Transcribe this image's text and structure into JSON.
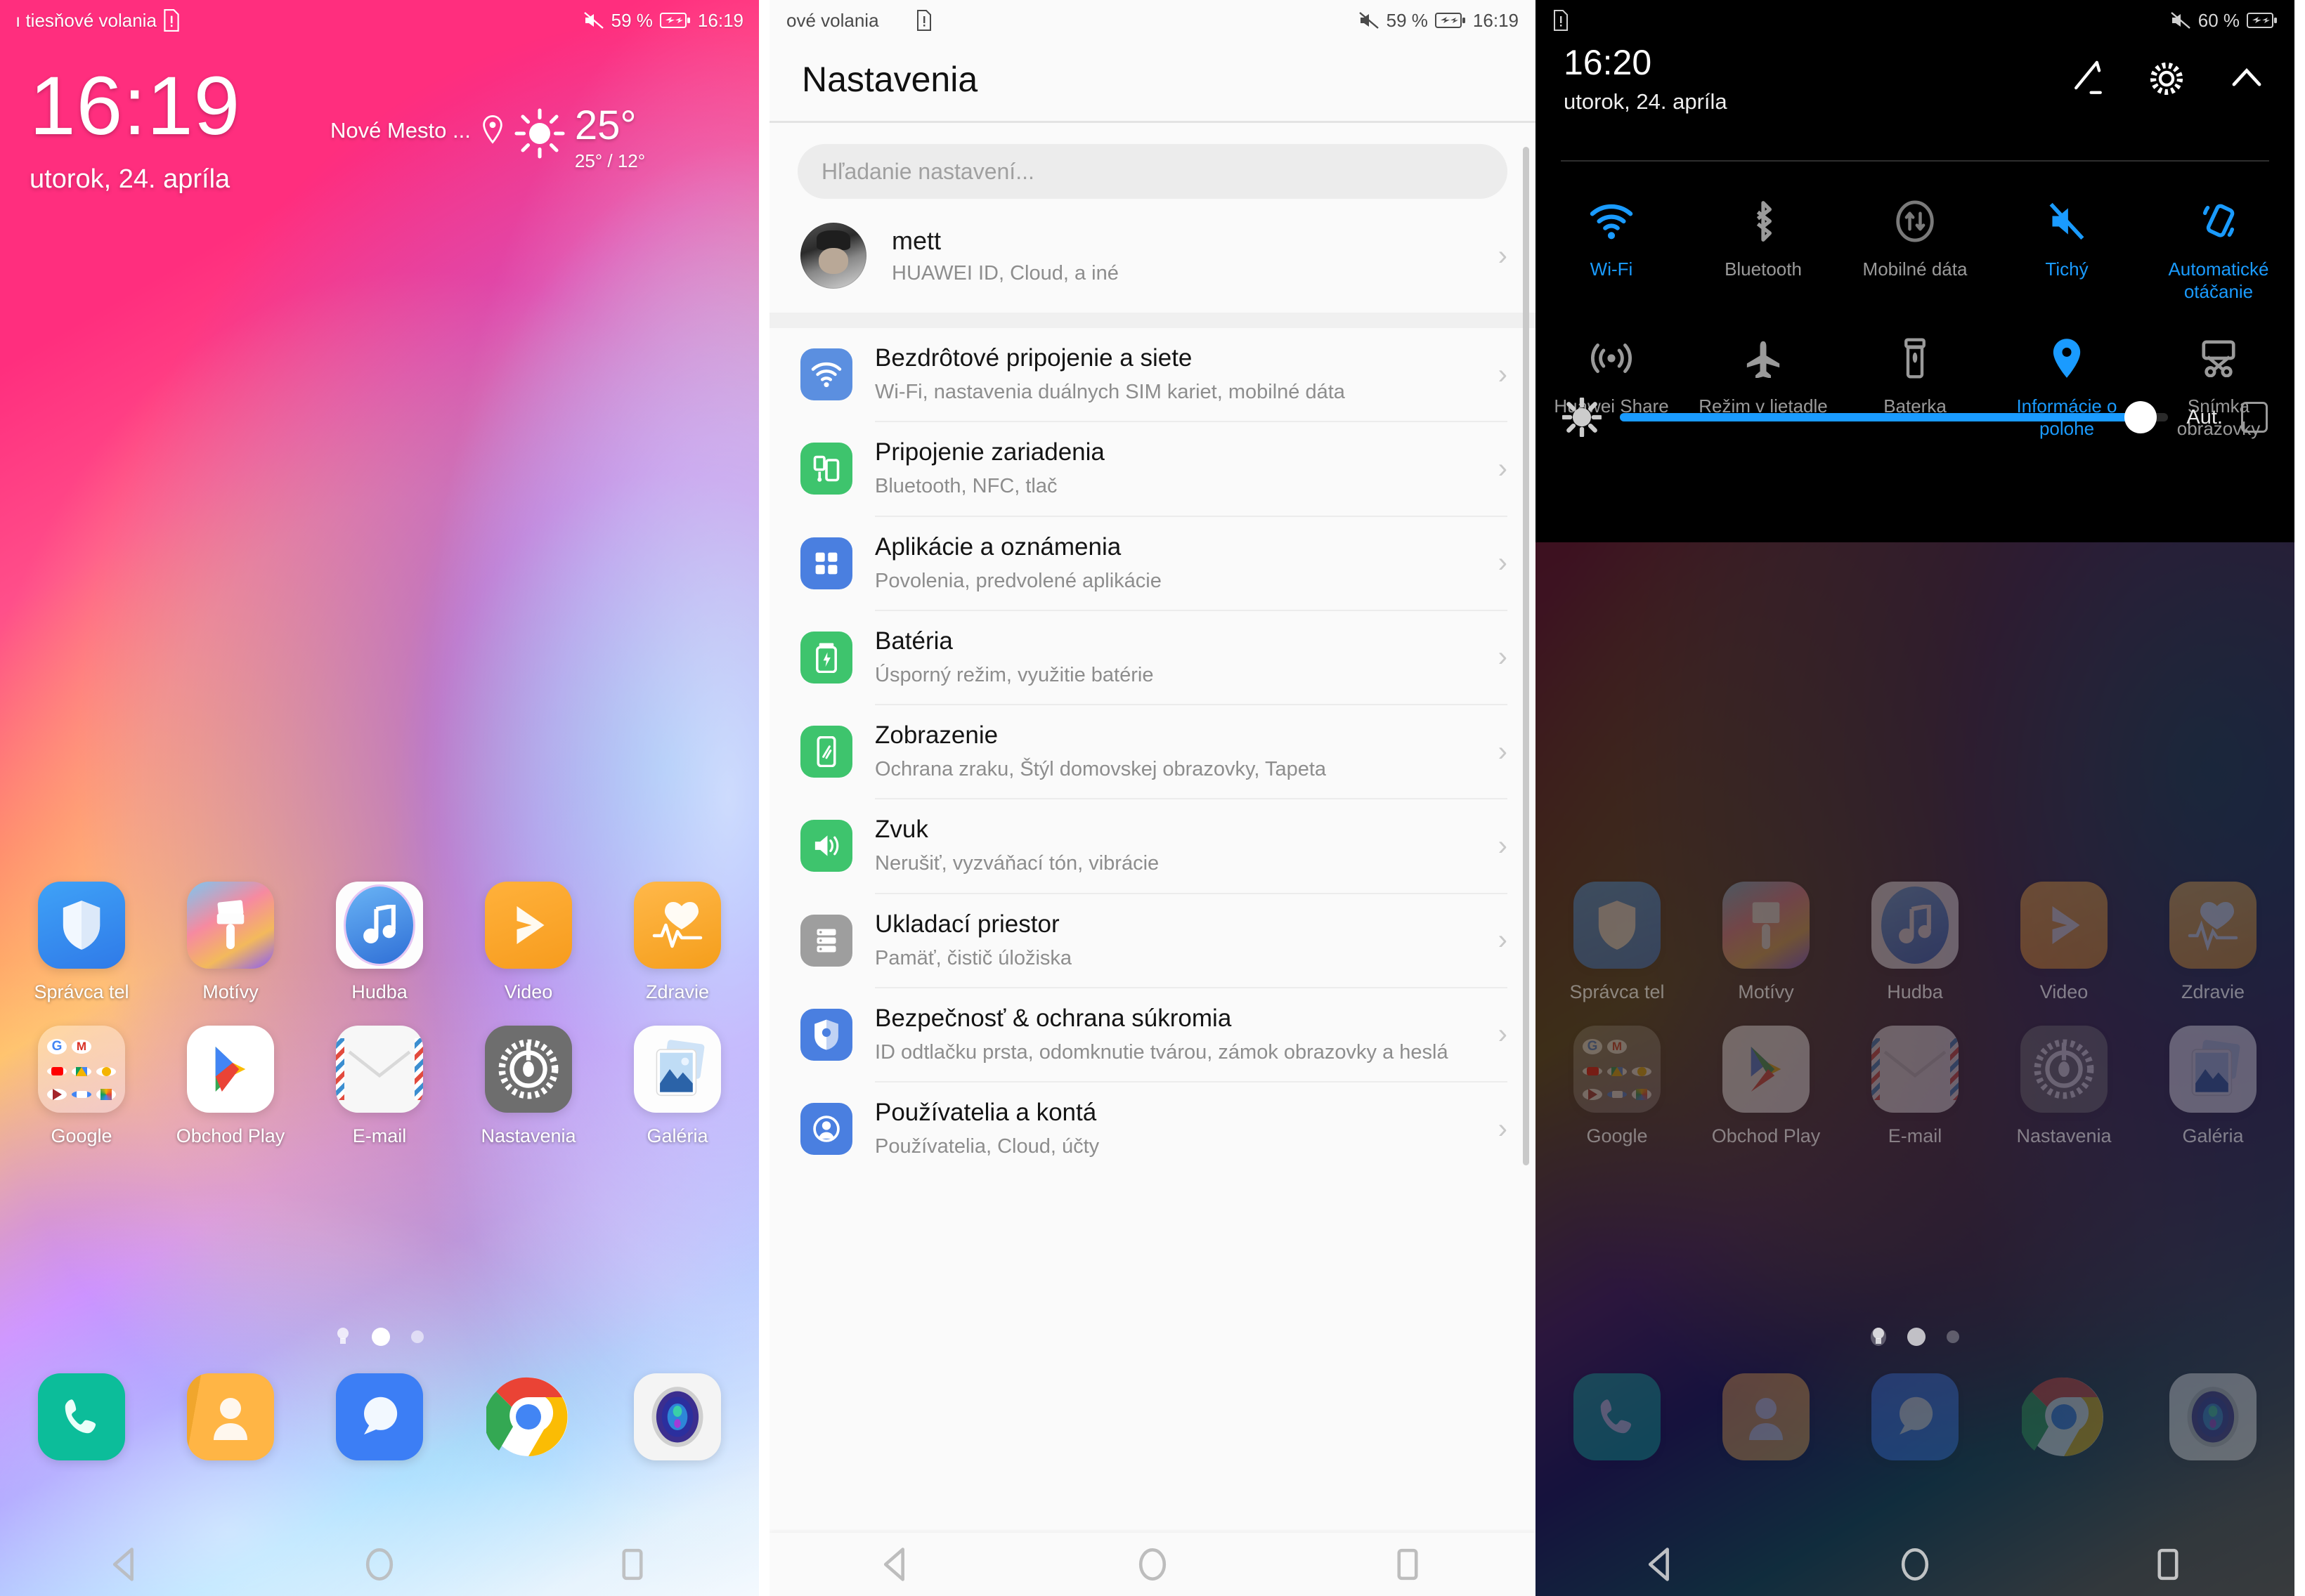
{
  "panel1": {
    "name": "home-screen",
    "statusbar": {
      "carrier": "ı tiesňové volania",
      "battery": "59 %",
      "clock": "16:19",
      "silent_icon": "mute-icon",
      "sim_icon": "sim-alert-icon",
      "battery_icon": "battery-charging-icon"
    },
    "lockscreen": {
      "time": "16:19",
      "date": "utorok, 24. apríla"
    },
    "weather": {
      "location": "Nové Mesto ...",
      "temp": "25°",
      "range": "25° / 12°",
      "icon": "sun-icon"
    },
    "apps_row1": [
      {
        "label": "Správca tel",
        "icon": "shield-icon"
      },
      {
        "label": "Motívy",
        "icon": "paintbrush-icon"
      },
      {
        "label": "Hudba",
        "icon": "music-note-icon"
      },
      {
        "label": "Video",
        "icon": "play-icon"
      },
      {
        "label": "Zdravie",
        "icon": "heart-pulse-icon"
      }
    ],
    "apps_row2": [
      {
        "label": "Google",
        "icon": "google-folder-icon"
      },
      {
        "label": "Obchod Play",
        "icon": "play-store-icon"
      },
      {
        "label": "E-mail",
        "icon": "envelope-icon"
      },
      {
        "label": "Nastavenia",
        "icon": "gear-icon"
      },
      {
        "label": "Galéria",
        "icon": "gallery-icon"
      }
    ],
    "dock": [
      {
        "label": "Telefón",
        "icon": "phone-icon"
      },
      {
        "label": "Kontakty",
        "icon": "contacts-icon"
      },
      {
        "label": "Správy",
        "icon": "message-icon"
      },
      {
        "label": "Chrome",
        "icon": "chrome-icon"
      },
      {
        "label": "Fotoaparát",
        "icon": "camera-icon"
      }
    ],
    "page_indicator": {
      "count": 3,
      "active_index": 1
    },
    "navbar": [
      {
        "name": "back-button",
        "icon": "triangle-back-icon"
      },
      {
        "name": "home-button",
        "icon": "circle-home-icon"
      },
      {
        "name": "recents-button",
        "icon": "square-recents-icon"
      }
    ]
  },
  "panel2": {
    "name": "settings-screen",
    "statusbar": {
      "carrier": "ové volania",
      "battery": "59 %",
      "clock": "16:19"
    },
    "title": "Nastavenia",
    "search": {
      "placeholder": "Hľadanie nastavení..."
    },
    "account": {
      "name": "mett",
      "subtitle": "HUAWEI ID, Cloud, a iné"
    },
    "items": [
      {
        "title": "Bezdrôtové pripojenie a siete",
        "subtitle": "Wi-Fi, nastavenia duálnych SIM kariet, mobilné dáta",
        "icon": "wifi-icon",
        "color": "#5b8fe0"
      },
      {
        "title": "Pripojenie zariadenia",
        "subtitle": "Bluetooth, NFC, tlač",
        "icon": "device-connect-icon",
        "color": "#3ec46d"
      },
      {
        "title": "Aplikácie a oznámenia",
        "subtitle": "Povolenia, predvolené aplikácie",
        "icon": "apps-grid-icon",
        "color": "#4a7fe0"
      },
      {
        "title": "Batéria",
        "subtitle": "Úsporný režim, využitie batérie",
        "icon": "battery-icon",
        "color": "#3ec46d"
      },
      {
        "title": "Zobrazenie",
        "subtitle": "Ochrana zraku, Štýl domovskej obrazovky, Tapeta",
        "icon": "display-icon",
        "color": "#3ec46d"
      },
      {
        "title": "Zvuk",
        "subtitle": "Nerušiť, vyzváňací tón, vibrácie",
        "icon": "sound-icon",
        "color": "#3ec46d"
      },
      {
        "title": "Ukladací priestor",
        "subtitle": "Pamäť, čistič úložiska",
        "icon": "storage-icon",
        "color": "#9e9e9e"
      },
      {
        "title": "Bezpečnosť & ochrana súkromia",
        "subtitle": "ID odtlačku prsta, odomknutie tvárou, zámok obrazovky a heslá",
        "icon": "security-shield-icon",
        "color": "#4a7fe0"
      },
      {
        "title": "Používatelia a kontá",
        "subtitle": "Používatelia, Cloud, účty",
        "icon": "user-account-icon",
        "color": "#4a7fe0"
      }
    ],
    "navbar": [
      {
        "name": "back-button",
        "icon": "triangle-back-icon"
      },
      {
        "name": "home-button",
        "icon": "circle-home-icon"
      },
      {
        "name": "recents-button",
        "icon": "square-recents-icon"
      }
    ]
  },
  "panel3": {
    "name": "quick-settings-shade",
    "statusbar": {
      "battery": "60 %",
      "sim_icon": "sim-alert-icon",
      "silent_icon": "mute-icon"
    },
    "header": {
      "time": "16:20",
      "date": "utorok, 24. apríla",
      "actions": [
        {
          "name": "edit-button",
          "icon": "pencil-icon"
        },
        {
          "name": "settings-button",
          "icon": "gear-icon"
        },
        {
          "name": "collapse-button",
          "icon": "chevron-up-icon"
        }
      ]
    },
    "toggles_row1": [
      {
        "label": "Wi-Fi",
        "icon": "wifi-icon",
        "on": true
      },
      {
        "label": "Bluetooth",
        "icon": "bluetooth-icon",
        "on": false
      },
      {
        "label": "Mobilné dáta",
        "icon": "mobile-data-icon",
        "on": false
      },
      {
        "label": "Tichý",
        "icon": "mute-icon",
        "on": true
      },
      {
        "label": "Automatické otáčanie",
        "icon": "auto-rotate-icon",
        "on": true
      }
    ],
    "toggles_row2": [
      {
        "label": "Huawei Share",
        "icon": "huawei-share-icon",
        "on": false
      },
      {
        "label": "Režim v lietadle",
        "icon": "airplane-icon",
        "on": false
      },
      {
        "label": "Baterka",
        "icon": "flashlight-icon",
        "on": false
      },
      {
        "label": "Informácie o polohe",
        "icon": "location-pin-icon",
        "on": true
      },
      {
        "label": "Snímka obrazovky",
        "icon": "screenshot-icon",
        "on": false
      }
    ],
    "brightness": {
      "icon": "brightness-sun-icon",
      "value_percent": 95,
      "auto_label": "Aut.",
      "auto_checked": false
    },
    "accent_color": "#1a9bff",
    "apps_row1": [
      {
        "label": "Správca tel"
      },
      {
        "label": "Motívy"
      },
      {
        "label": "Hudba"
      },
      {
        "label": "Video"
      },
      {
        "label": "Zdravie"
      }
    ],
    "apps_row2": [
      {
        "label": "Google"
      },
      {
        "label": "Obchod Play"
      },
      {
        "label": "E-mail"
      },
      {
        "label": "Nastavenia"
      },
      {
        "label": "Galéria"
      }
    ],
    "navbar": [
      {
        "name": "back-button",
        "icon": "triangle-back-icon"
      },
      {
        "name": "home-button",
        "icon": "circle-home-icon"
      },
      {
        "name": "recents-button",
        "icon": "square-recents-icon"
      }
    ]
  }
}
